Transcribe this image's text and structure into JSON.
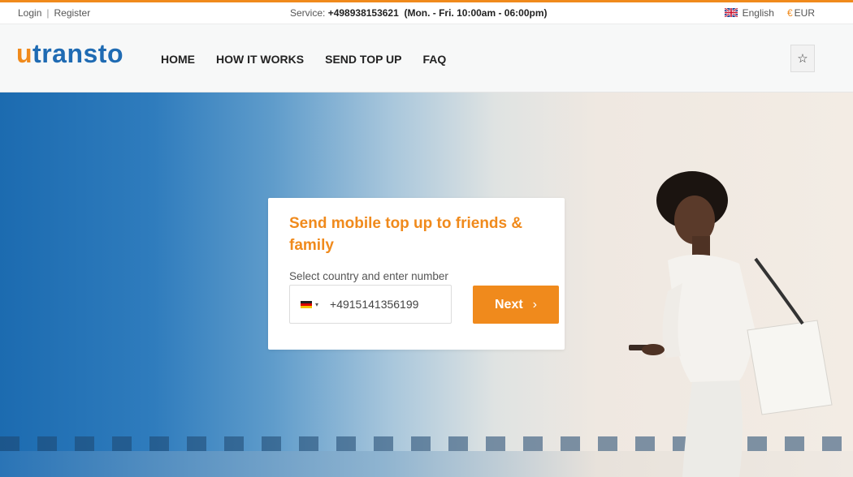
{
  "topbar": {
    "login": "Login",
    "separator": "|",
    "register": "Register",
    "service_prefix": "Service: ",
    "service_phone": "+498938153621",
    "service_hours": "(Mon. - Fri. 10:00am - 06:00pm)",
    "language": "English",
    "currency_symbol": "€",
    "currency": "EUR"
  },
  "header": {
    "logo_u": "u",
    "logo_rest": "transto",
    "nav": [
      "HOME",
      "HOW IT WORKS",
      "SEND TOP UP",
      "FAQ"
    ],
    "favorite_icon": "☆"
  },
  "topup_card": {
    "title": "Send mobile top up to friends & family",
    "field_label": "Select country and enter number",
    "country_flag": "germany-flag-icon",
    "phone_value": "+4915141356199",
    "next_label": "Next",
    "next_chevron": "›"
  },
  "colors": {
    "accent": "#f08a1c",
    "brand_blue": "#1f6bb3"
  }
}
